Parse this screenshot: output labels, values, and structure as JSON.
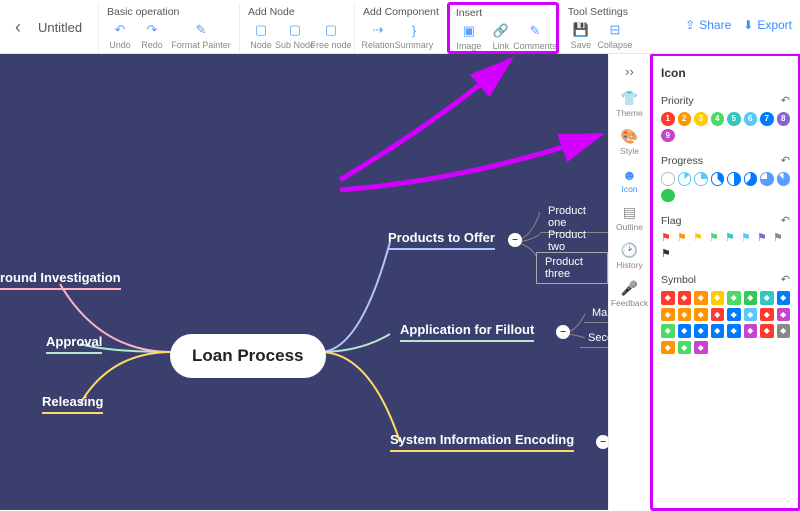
{
  "title": "Untitled",
  "toolbar": {
    "basic": {
      "label": "Basic operation",
      "undo": "Undo",
      "redo": "Redo",
      "format": "Format Painter"
    },
    "addnode": {
      "label": "Add Node",
      "node": "Node",
      "subnode": "Sub Node",
      "freenode": "Free node"
    },
    "addcomp": {
      "label": "Add Component",
      "relation": "Relation",
      "summary": "Summary"
    },
    "insert": {
      "label": "Insert",
      "image": "Image",
      "link": "Link",
      "comments": "Comments"
    },
    "toolset": {
      "label": "Tool Settings",
      "save": "Save",
      "collapse": "Collapse"
    },
    "share": "Share",
    "export": "Export"
  },
  "side": {
    "theme": "Theme",
    "style": "Style",
    "icon": "Icon",
    "outline": "Outline",
    "history": "History",
    "feedback": "Feedback"
  },
  "panel": {
    "title": "Icon",
    "priority": "Priority",
    "progress": "Progress",
    "flag": "Flag",
    "symbol": "Symbol",
    "priority_colors": [
      "#ff3b30",
      "#ff9500",
      "#ffcc00",
      "#4cd964",
      "#34c7c0",
      "#5ac8fa",
      "#007aff",
      "#8a63d2",
      "#c644cf"
    ],
    "progress_colors": [
      "#bbb",
      "#5ac8fa",
      "#5ac8fa",
      "#007aff",
      "#007aff",
      "#007aff",
      "#5a9cff",
      "#5a9cff",
      "#34c759"
    ],
    "flag_colors": [
      "#ff3b30",
      "#ff9500",
      "#ffcc00",
      "#4cd964",
      "#34c7c0",
      "#5ac8fa",
      "#8a63d2",
      "#888",
      "#333"
    ],
    "symbol_colors": [
      "#ff3b30",
      "#ff3b30",
      "#ff9500",
      "#ffcc00",
      "#4cd964",
      "#34c759",
      "#34c7c0",
      "#007aff",
      "#ff9500",
      "#ff9500",
      "#ff9500",
      "#ff3b30",
      "#007aff",
      "#5ac8fa",
      "#ff3b30",
      "#c644cf",
      "#4cd964",
      "#007aff",
      "#007aff",
      "#007aff",
      "#007aff",
      "#c644cf",
      "#ff3b30",
      "#888",
      "#ff9500",
      "#4cd964",
      "#c644cf"
    ]
  },
  "map": {
    "center": "Loan Process",
    "left": [
      "round Investigation",
      "Approval",
      "Releasing"
    ],
    "right": [
      {
        "t": "Products to Offer",
        "c": [
          "Product one",
          "Product two",
          "Product three"
        ]
      },
      {
        "t": "Application for Fillout",
        "c": [
          "Main",
          "Secondary"
        ]
      },
      {
        "t": "System Information Encoding",
        "c": []
      }
    ]
  }
}
